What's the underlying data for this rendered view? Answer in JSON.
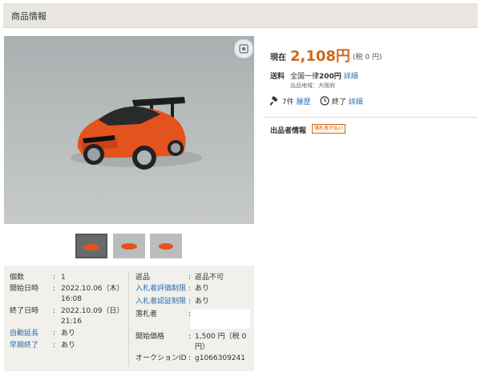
{
  "header": {
    "title": "商品情報"
  },
  "price": {
    "label": "現在",
    "value": "2,108円",
    "tax": "(税 0 円)"
  },
  "shipping": {
    "label": "送料",
    "text_pre": "全国一律",
    "amount": "200円",
    "link": "詳細",
    "origin": "出品地域：大阪府"
  },
  "bids": {
    "count": "7件",
    "history_link": "履歴",
    "status": "終了",
    "detail_link": "詳細"
  },
  "seller": {
    "label": "出品者情報",
    "badge": "落札者が払い"
  },
  "thumbnails": [
    {
      "name": "thumb-1",
      "selected": true
    },
    {
      "name": "thumb-2",
      "selected": false
    },
    {
      "name": "thumb-3",
      "selected": false
    }
  ],
  "details": {
    "left": [
      {
        "label": "個数",
        "value": "1"
      },
      {
        "label": "開始日時",
        "value": "2022.10.06（木）",
        "value2": "16:08"
      },
      {
        "label": "終了日時",
        "value": "2022.10.09（日）",
        "value2": "21:16"
      },
      {
        "label": "自動延長",
        "value": "あり"
      },
      {
        "label": "早期終了",
        "value": "あり"
      }
    ],
    "right": [
      {
        "label": "返品",
        "value": "返品不可"
      },
      {
        "label": "入札者評価制限",
        "value": "あり"
      },
      {
        "label": "入札者認証制限",
        "value": "あり"
      },
      {
        "label": "落札者",
        "value": ""
      },
      {
        "label": "開始価格",
        "value": "1,500 円（税 0",
        "value2": "円）"
      },
      {
        "label": "オークションID",
        "value": "g1066309241"
      }
    ]
  },
  "colors": {
    "accent": "#d0661a",
    "link": "#2b6cb0",
    "header_bg": "#e8e6df",
    "details_bg": "#f1f0ec"
  }
}
